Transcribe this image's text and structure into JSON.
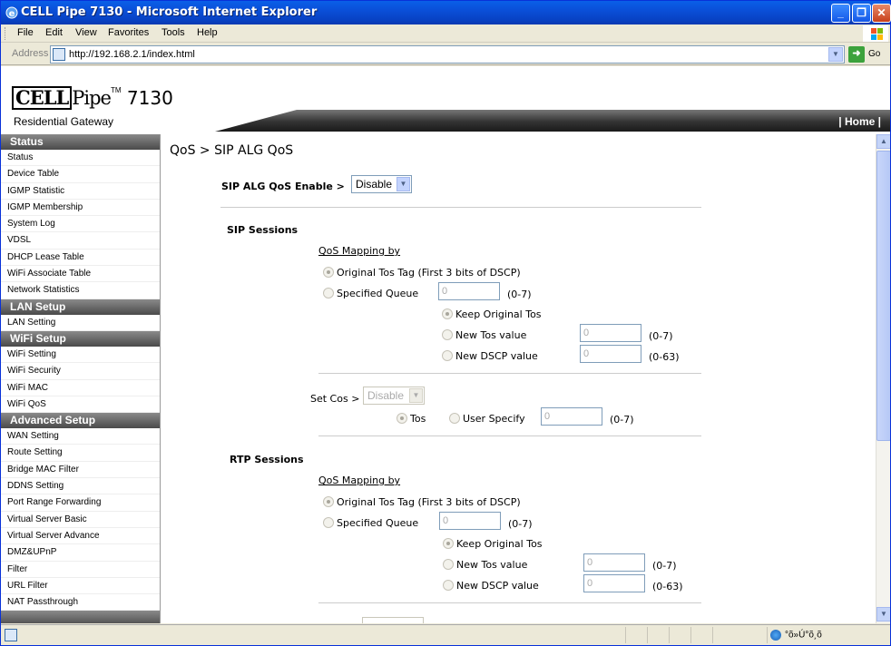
{
  "window": {
    "title": "CELL Pipe 7130 - Microsoft Internet Explorer"
  },
  "menu": [
    "File",
    "Edit",
    "View",
    "Favorites",
    "Tools",
    "Help"
  ],
  "address": {
    "label": "Address",
    "url": "http://192.168.2.1/index.html",
    "go": "Go"
  },
  "brand": {
    "cell": "CELL",
    "pipe": "Pipe",
    "tm": "TM",
    "model": " 7130",
    "subtitle": "Residential Gateway"
  },
  "banner": {
    "home": "| Home |"
  },
  "sidebar": {
    "sections": [
      {
        "title": "Status",
        "items": [
          "Status",
          "Device Table",
          "IGMP Statistic",
          "IGMP Membership",
          "System Log",
          "VDSL",
          "DHCP Lease Table",
          "WiFi Associate Table",
          "Network Statistics"
        ]
      },
      {
        "title": "LAN Setup",
        "items": [
          "LAN Setting"
        ]
      },
      {
        "title": "WiFi Setup",
        "items": [
          "WiFi Setting",
          "WiFi Security",
          "WiFi MAC",
          "WiFi QoS"
        ]
      },
      {
        "title": "Advanced Setup",
        "items": [
          "WAN Setting",
          "Route Setting",
          "Bridge MAC Filter",
          "DDNS Setting",
          "Port Range Forwarding",
          "Virtual Server Basic",
          "Virtual Server Advance",
          "DMZ&UPnP",
          "Filter",
          "URL Filter",
          "NAT Passthrough"
        ]
      }
    ]
  },
  "main": {
    "title": "QoS > SIP ALG QoS",
    "enable_label": "SIP ALG QoS Enable >",
    "enable_value": "Disable",
    "sip": {
      "heading": "SIP Sessions",
      "mapping_label": "QoS Mapping by",
      "opt_original": "Original Tos Tag (First 3 bits of DSCP)",
      "opt_specified": "Specified Queue",
      "queue_value": "0",
      "queue_range": "(0-7)",
      "keep_tos": "Keep Original Tos",
      "new_tos": "New Tos value",
      "new_tos_value": "0",
      "new_tos_range": "(0-7)",
      "new_dscp": "New DSCP value",
      "new_dscp_value": "0",
      "new_dscp_range": "(0-63)",
      "set_cos_label": "Set Cos >",
      "set_cos_value": "Disable",
      "tos_label": "Tos",
      "user_specify": "User Specify",
      "user_value": "0",
      "user_range": "(0-7)"
    },
    "rtp": {
      "heading": "RTP Sessions",
      "mapping_label": "QoS Mapping by",
      "opt_original": "Original Tos Tag (First 3 bits of DSCP)",
      "opt_specified": "Specified Queue",
      "queue_value": "0",
      "queue_range": "(0-7)",
      "keep_tos": "Keep Original Tos",
      "new_tos": "New Tos value",
      "new_tos_value": "0",
      "new_tos_range": "(0-7)",
      "new_dscp": "New DSCP value",
      "new_dscp_value": "0",
      "new_dscp_range": "(0-63)"
    }
  },
  "status": {
    "zone": "°õ»Ú°õ¸õ"
  }
}
